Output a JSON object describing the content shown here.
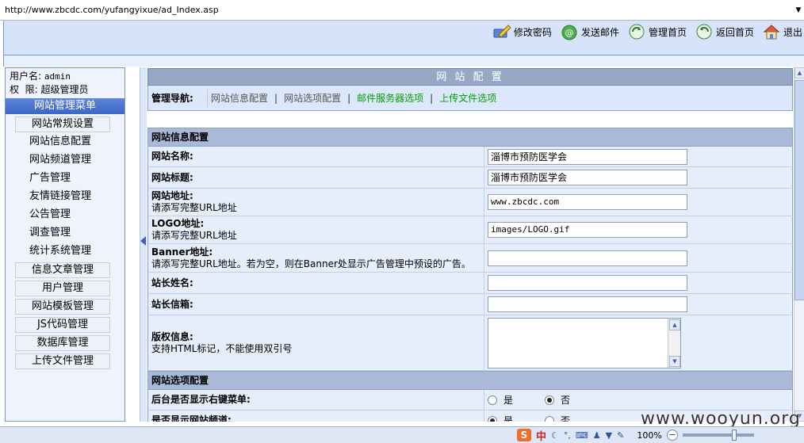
{
  "address_bar": {
    "url": "http://www.zbcdc.com/yufangyixue/ad_Index.asp"
  },
  "toolbar": {
    "items": [
      {
        "label": "修改密码",
        "icon": "pen-icon"
      },
      {
        "label": "发送邮件",
        "icon": "mail-icon"
      },
      {
        "label": "管理首页",
        "icon": "refresh-icon"
      },
      {
        "label": "返回首页",
        "icon": "back-icon"
      },
      {
        "label": "退出",
        "icon": "home-icon"
      }
    ]
  },
  "sidebar": {
    "username_label": "用户名:",
    "username": "admin",
    "role_label": "权  限:",
    "role": "超级管理员",
    "menu_title": "网站管理菜单",
    "groups": [
      {
        "label": "网站常规设置",
        "items": [
          "网站信息配置",
          "网站频道管理",
          "广告管理",
          "友情链接管理",
          "公告管理",
          "调查管理",
          "统计系统管理"
        ]
      },
      {
        "label": "信息文章管理",
        "items": []
      },
      {
        "label": "用户管理",
        "items": []
      },
      {
        "label": "网站模板管理",
        "items": []
      },
      {
        "label": "JS代码管理",
        "items": []
      },
      {
        "label": "数据库管理",
        "items": []
      },
      {
        "label": "上传文件管理",
        "items": []
      }
    ]
  },
  "main": {
    "title": "网 站 配 置",
    "nav_label": "管理导航:",
    "nav_links": [
      {
        "label": "网站信息配置",
        "color": "#555555"
      },
      {
        "label": "网站选项配置",
        "color": "#555555"
      },
      {
        "label": "邮件服务器选项",
        "color": "#00a000"
      },
      {
        "label": "上传文件选项",
        "color": "#00a000"
      }
    ],
    "section1": "网站信息配置",
    "fields": {
      "site_name": {
        "label": "网站名称:",
        "value": "淄博市预防医学会"
      },
      "site_title": {
        "label": "网站标题:",
        "value": "淄博市预防医学会"
      },
      "site_url": {
        "label": "网站地址:",
        "hint": "请添写完整URL地址",
        "value": "www.zbcdc.com"
      },
      "logo_url": {
        "label": "LOGO地址:",
        "hint": "请添写完整URL地址",
        "value": "images/LOGO.gif"
      },
      "banner_url": {
        "label": "Banner地址:",
        "hint": "请添写完整URL地址。若为空，则在Banner处显示广告管理中预设的广告。",
        "value": ""
      },
      "admin_name": {
        "label": "站长姓名:",
        "value": ""
      },
      "admin_email": {
        "label": "站长信箱:",
        "value": ""
      },
      "copyright": {
        "label": "版权信息:",
        "hint": "支持HTML标记，不能使用双引号",
        "value": ""
      }
    },
    "section2": "网站选项配置",
    "options": {
      "right_menu": {
        "label": "后台是否显示右键菜单:",
        "yes": "是",
        "no": "否",
        "selected": "no"
      },
      "show_channel": {
        "label": "是否显示网站频道:",
        "yes": "是",
        "no": "否",
        "selected": "yes"
      }
    }
  },
  "statusbar": {
    "ime_logo": "S",
    "ime_lang": "中",
    "zoom": "100%"
  },
  "watermark": "www.wooyun.org"
}
